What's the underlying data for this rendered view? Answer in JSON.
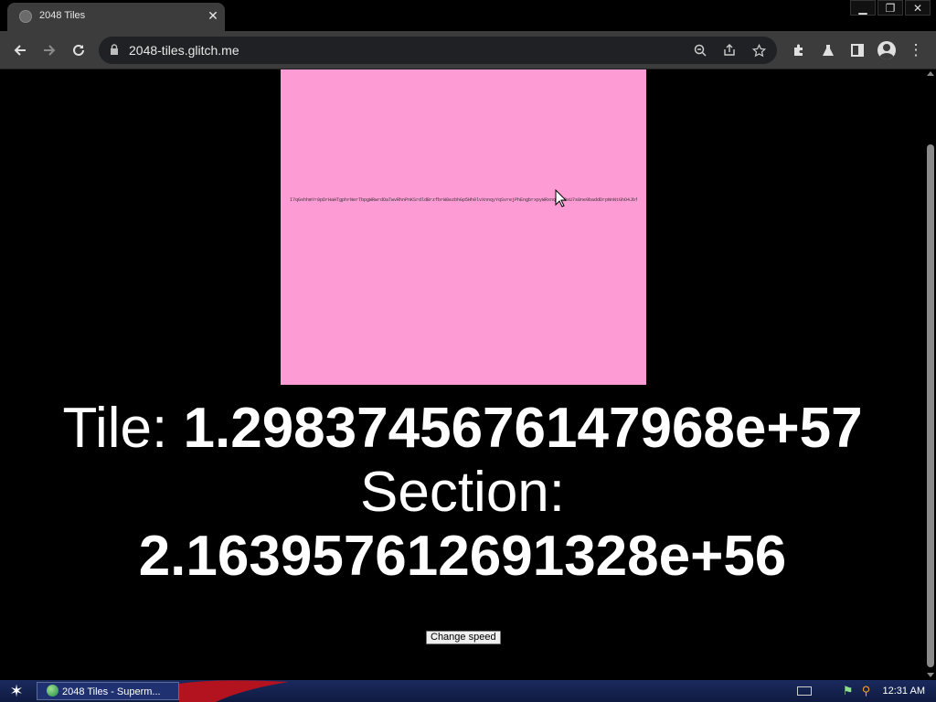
{
  "browser": {
    "tab_title": "2048 Tiles",
    "url": "2048-tiles.glitch.me"
  },
  "page": {
    "tile_text": "I7qGshhmYr0pDrHaHTgphrNerTbpgWRwrdOaTwvRhnPnKSrdldBrzfbrW8ezbhGp5Hh0lvXnnqyYqSvrejPhEngbrxpyWRxnqyTwOxU7s8ne9baddDrpNnNtGhO4JbfwMVWOt",
    "tile_color": "#fd9bd5",
    "tile_label": "Tile:",
    "tile_value": "1.2983745676147968e+57",
    "section_label": "Section:",
    "section_value": "2.163957612691328e+56",
    "speed_button": "Change speed"
  },
  "taskbar": {
    "task_label": "2048 Tiles - Superm...",
    "clock": "12:31 AM"
  },
  "icons": [
    "back-icon",
    "forward-icon",
    "reload-icon",
    "lock-icon",
    "zoom-icon",
    "share-icon",
    "bookmark-star-icon",
    "extensions-icon",
    "labs-icon",
    "side-panel-icon",
    "profile-icon",
    "menu-icon"
  ]
}
